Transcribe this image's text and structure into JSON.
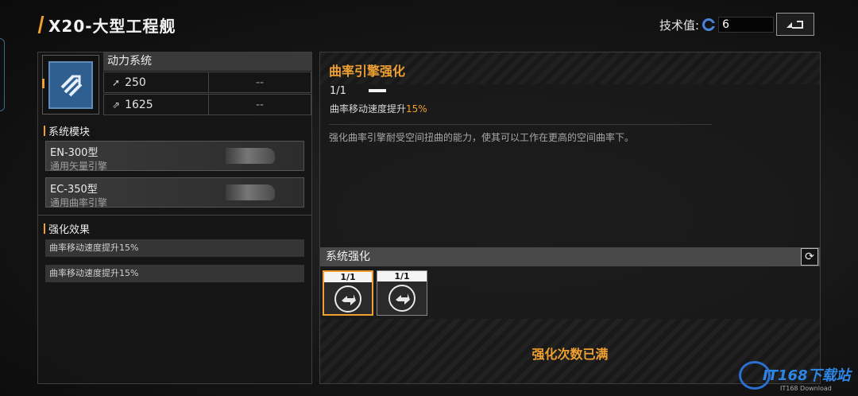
{
  "header": {
    "title": "X20-大型工程舰",
    "tech_label": "技术值:",
    "tech_value": "6",
    "back_icon": "back-arrow-icon"
  },
  "power": {
    "title": "动力系统",
    "icon": "power-system-icon",
    "stats": [
      {
        "icon": "speed-icon",
        "value": "250",
        "extra": "--"
      },
      {
        "icon": "warp-speed-icon",
        "value": "1625",
        "extra": "--"
      }
    ]
  },
  "modules": {
    "title": "系统模块",
    "items": [
      {
        "name": "EN-300型",
        "sub": "通用矢量引擎"
      },
      {
        "name": "EC-350型",
        "sub": "通用曲率引擎"
      }
    ]
  },
  "effects": {
    "title": "强化效果",
    "items": [
      "曲率移动速度提升15%",
      "曲率移动速度提升15%"
    ]
  },
  "upgrade": {
    "name": "曲率引擎强化",
    "level": "1/1",
    "level_fraction": 1.0,
    "effect_prefix": "曲率移动速度提升",
    "effect_value": "15%",
    "description": "强化曲率引擎耐受空间扭曲的能力，使其可以工作在更高的空间曲率下。"
  },
  "system_upgrade": {
    "title": "系统强化",
    "slots": [
      {
        "level": "1/1",
        "selected": true,
        "icon": "engine-upgrade-icon"
      },
      {
        "level": "1/1",
        "selected": false,
        "icon": "engine-upgrade-icon"
      }
    ],
    "status": "强化次数已满"
  },
  "watermark": {
    "text": "IT168下载站",
    "sub": "IT168 Download"
  },
  "colors": {
    "accent": "#f0a030",
    "tech_blue": "#4a82d8"
  }
}
